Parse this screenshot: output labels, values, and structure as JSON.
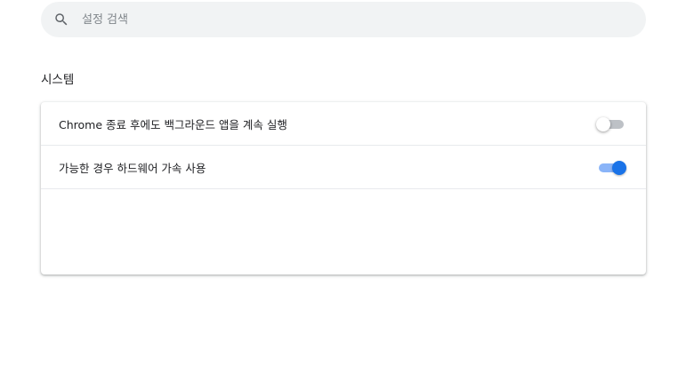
{
  "search": {
    "placeholder": "설정 검색",
    "icon": "search-icon"
  },
  "section": {
    "title": "시스템"
  },
  "settings": [
    {
      "label": "Chrome 종료 후에도 백그라운드 앱을 계속 실행",
      "enabled": false
    },
    {
      "label": "가능한 경우 하드웨어 가속 사용",
      "enabled": true
    }
  ],
  "colors": {
    "accent": "#1a73e8",
    "toggle_on_track": "#8ab4f8",
    "toggle_off_track": "#bdc1c6",
    "search_bg": "#f1f3f4"
  }
}
